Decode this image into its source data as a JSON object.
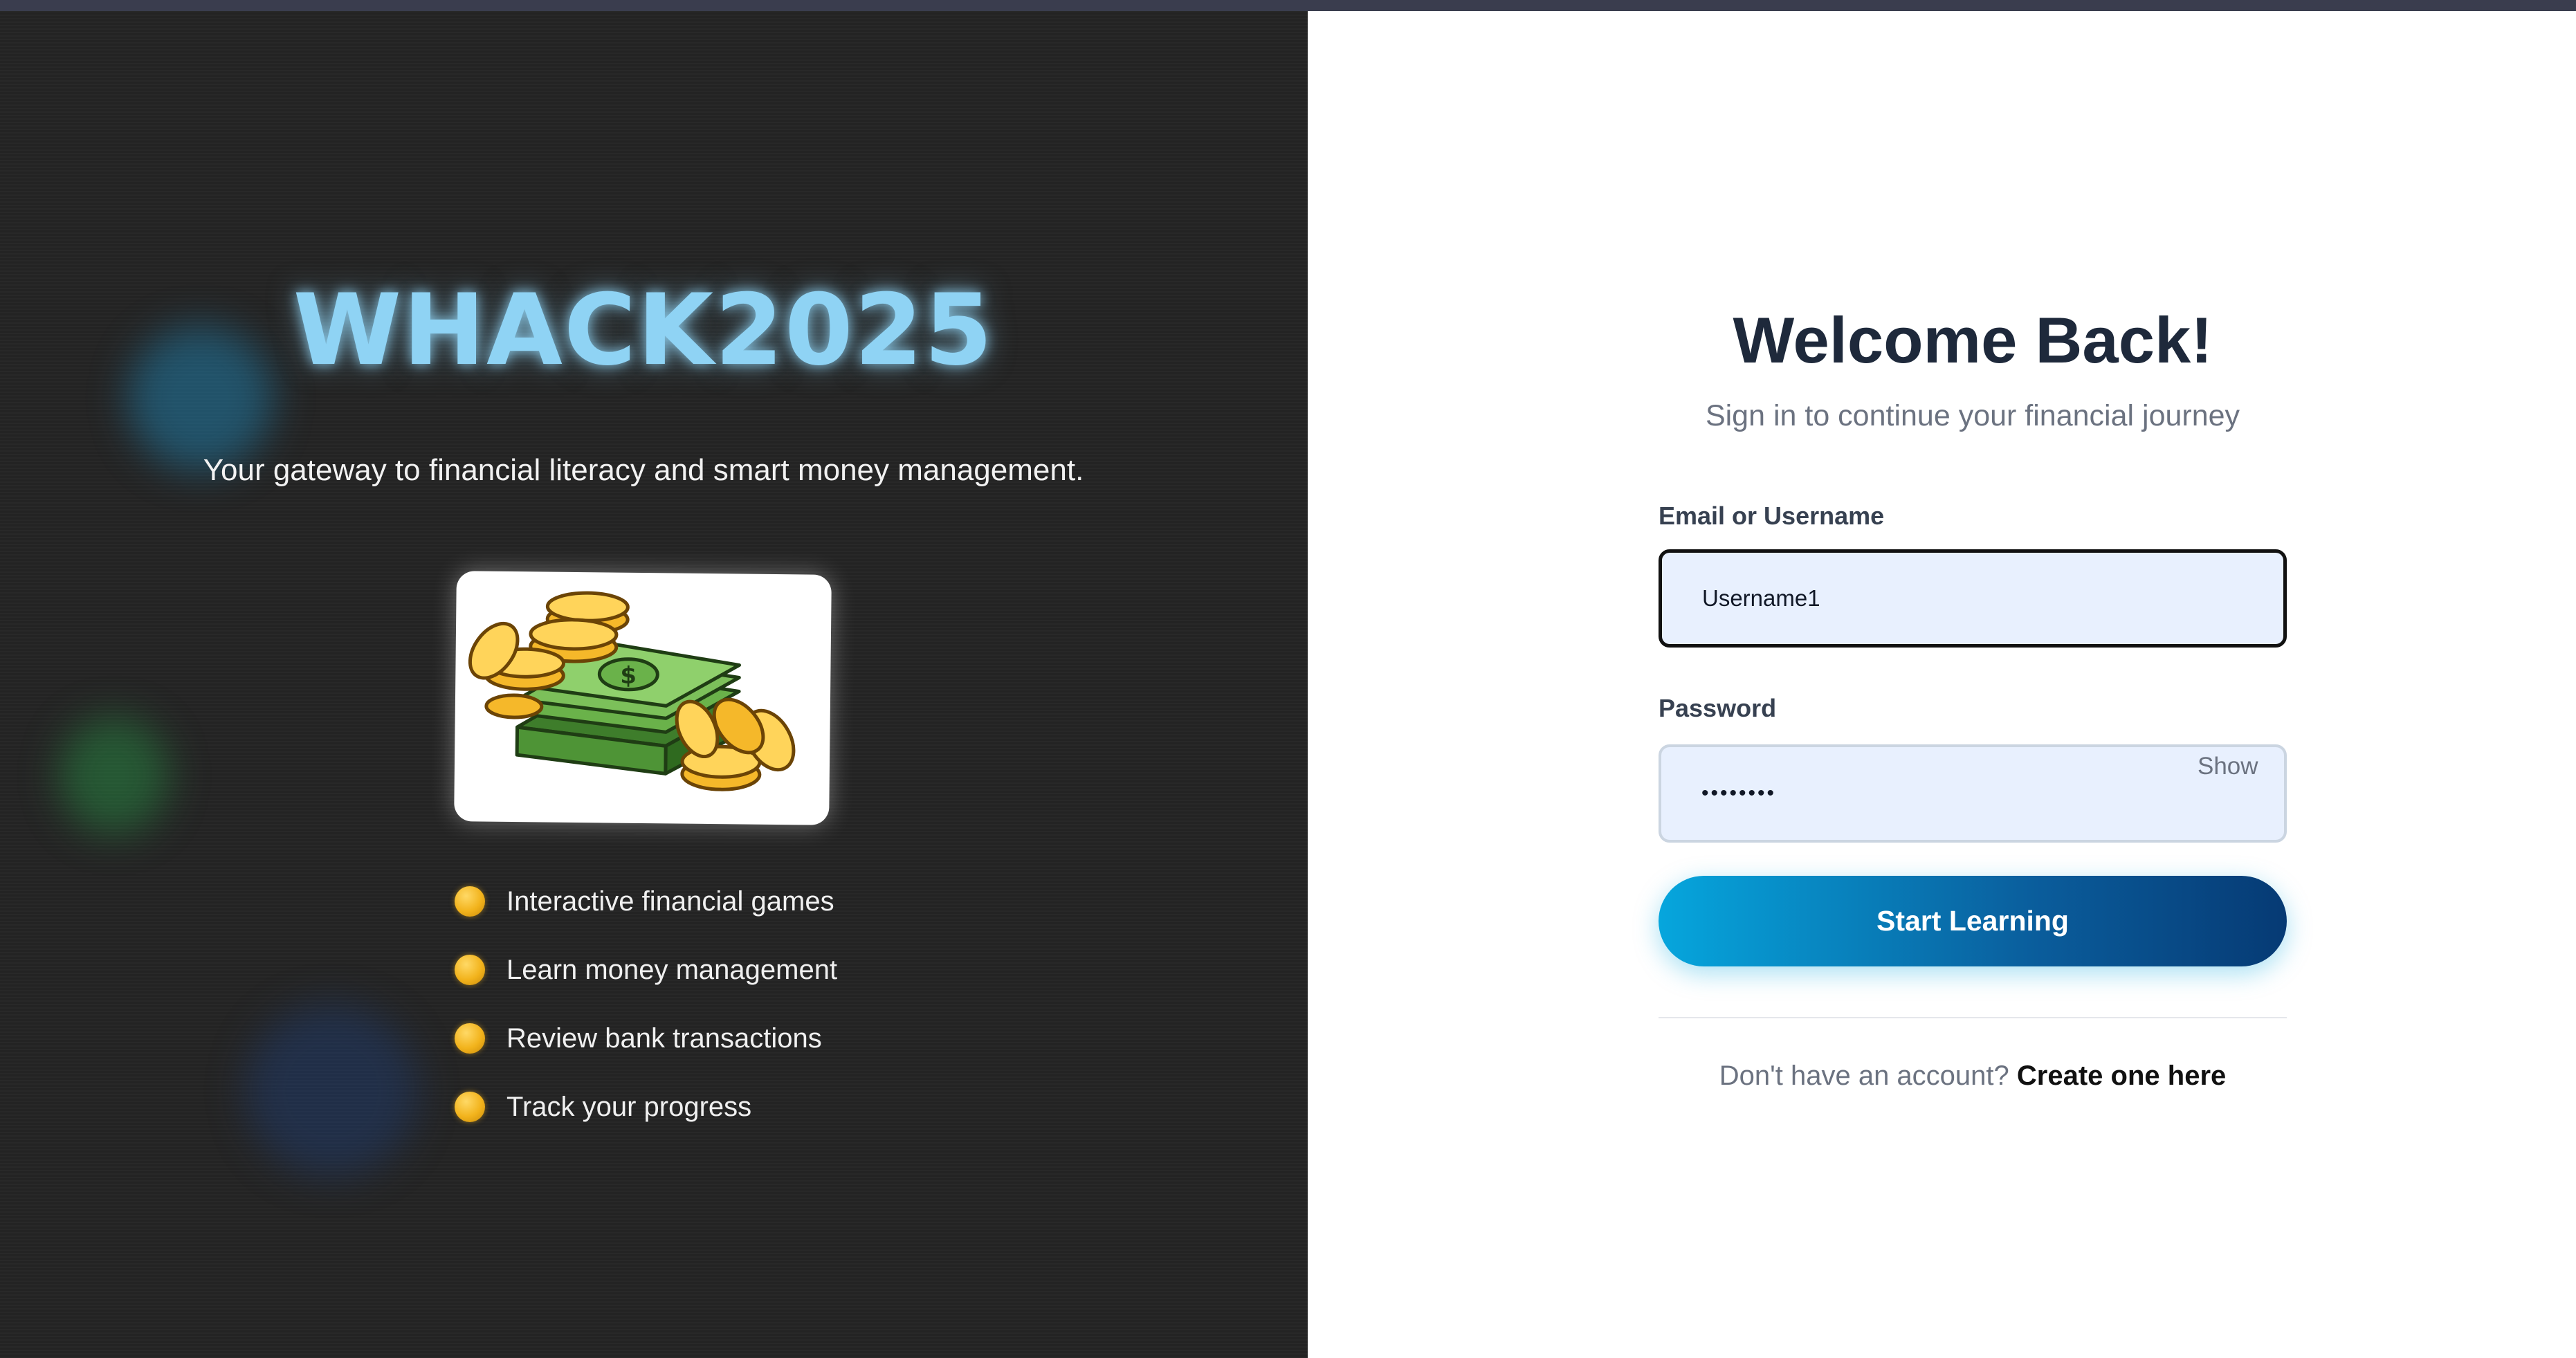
{
  "brand": {
    "title": "WHACK2025",
    "tagline": "Your gateway to financial literacy and smart money management."
  },
  "features": [
    {
      "label": "Interactive financial games"
    },
    {
      "label": "Learn money management"
    },
    {
      "label": "Review bank transactions"
    },
    {
      "label": "Track your progress"
    }
  ],
  "login": {
    "heading": "Welcome Back!",
    "subheading": "Sign in to continue your financial journey",
    "email_label": "Email or Username",
    "email_value": "Username1",
    "password_label": "Password",
    "password_value": "password",
    "show_label": "Show",
    "submit_label": "Start Learning",
    "signup_prompt": "Don't have an account?",
    "signup_link": "Create one here"
  },
  "colors": {
    "left_background": "#232323",
    "brand_glow": "#8fd3f4",
    "feature_dot": "#f2b31c",
    "button_start": "#06a6dd",
    "button_end": "#063a74",
    "input_background": "#e8f0fe"
  }
}
